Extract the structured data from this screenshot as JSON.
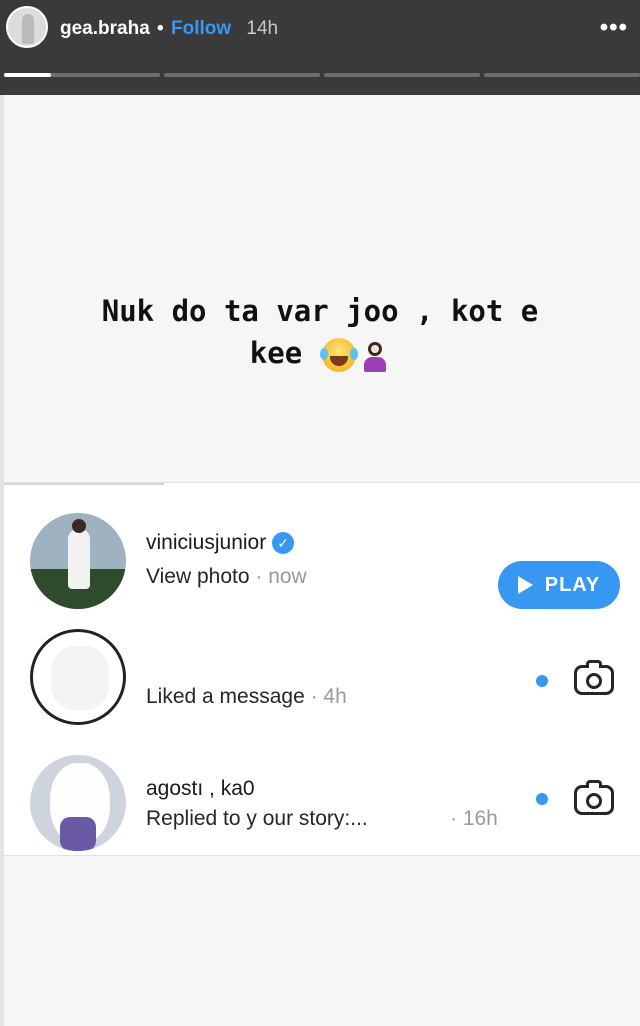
{
  "header": {
    "username": "gea.braha",
    "separator": "•",
    "follow_label": "Follow",
    "time": "14h",
    "more_label": "•••",
    "story_progress": [
      0.3,
      0,
      0,
      0
    ]
  },
  "story": {
    "caption_line1": "Nuk do ta var joo , kot e",
    "caption_line2": "kee"
  },
  "activity": {
    "rows": [
      {
        "name": "viniciusjunior",
        "verified": true,
        "action": "View photo",
        "time": "· now",
        "button_label": "PLAY"
      },
      {
        "name": "",
        "action": "Liked a message",
        "time": "· 4h"
      },
      {
        "name": "agostı ,  ka0",
        "action": "Replied to y our story:...",
        "time": "· 16h"
      }
    ]
  },
  "colors": {
    "accent": "#3897f0",
    "header_bg": "#3a3a3a",
    "story_bg": "#f6f6f6"
  },
  "icons": [
    "more-options-icon",
    "verified-badge-icon",
    "play-icon",
    "unread-dot-icon",
    "camera-icon"
  ]
}
